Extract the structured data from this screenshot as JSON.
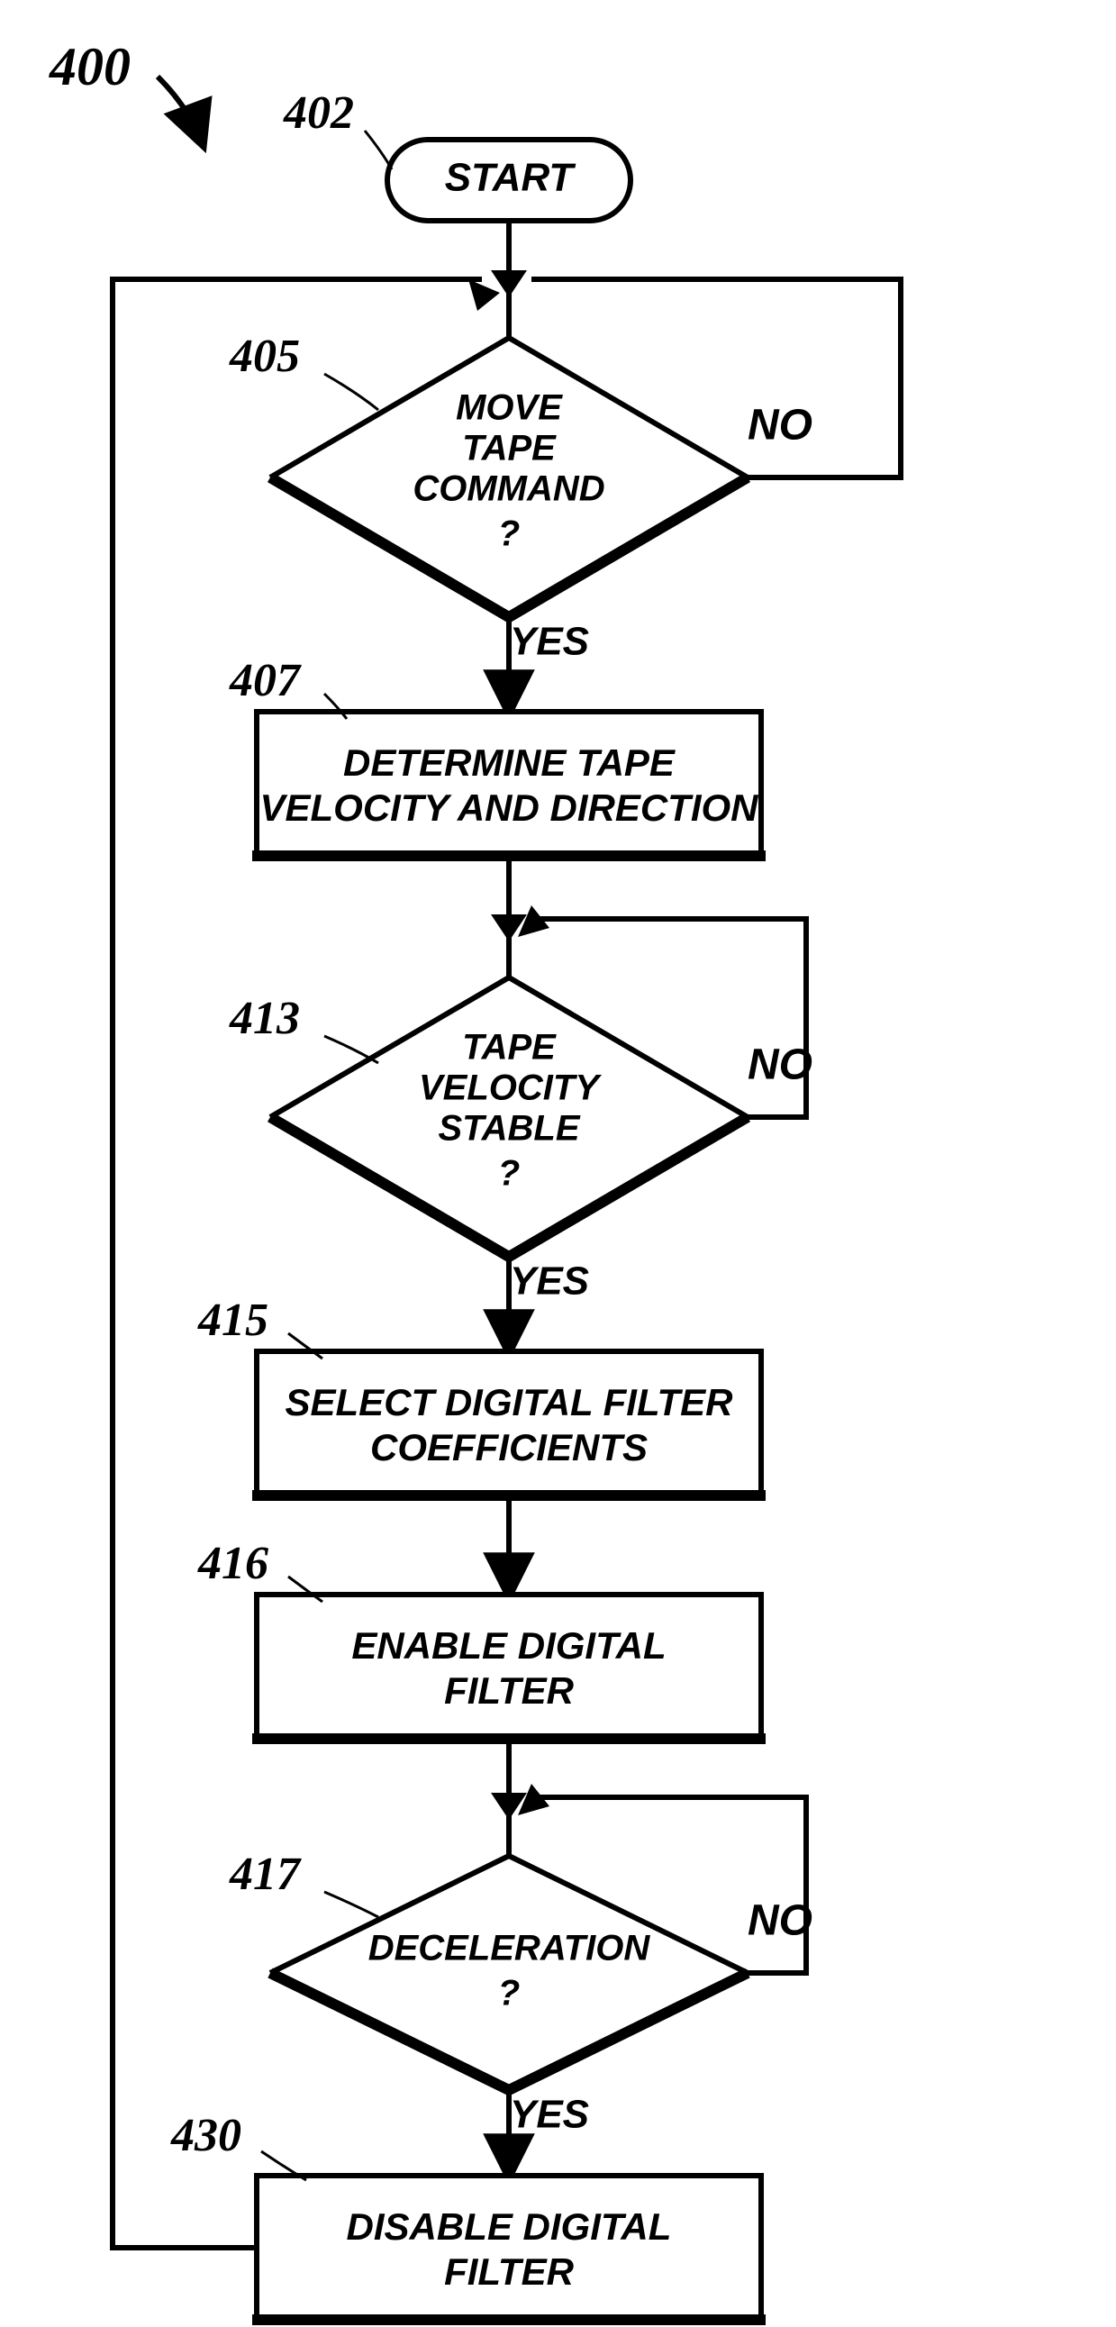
{
  "title_ref": "400",
  "start": {
    "ref": "402",
    "label": "START"
  },
  "d1": {
    "ref": "405",
    "l1": "MOVE",
    "l2": "TAPE",
    "l3": "COMMAND",
    "l4": "?",
    "yes": "YES",
    "no": "NO"
  },
  "p1": {
    "ref": "407",
    "l1": "DETERMINE TAPE",
    "l2": "VELOCITY AND DIRECTION"
  },
  "d2": {
    "ref": "413",
    "l1": "TAPE",
    "l2": "VELOCITY",
    "l3": "STABLE",
    "l4": "?",
    "yes": "YES",
    "no": "NO"
  },
  "p2": {
    "ref": "415",
    "l1": "SELECT DIGITAL FILTER",
    "l2": "COEFFICIENTS"
  },
  "p3": {
    "ref": "416",
    "l1": "ENABLE DIGITAL",
    "l2": "FILTER"
  },
  "d3": {
    "ref": "417",
    "l1": "DECELERATION",
    "l2": "?",
    "yes": "YES",
    "no": "NO"
  },
  "p4": {
    "ref": "430",
    "l1": "DISABLE DIGITAL",
    "l2": "FILTER"
  }
}
